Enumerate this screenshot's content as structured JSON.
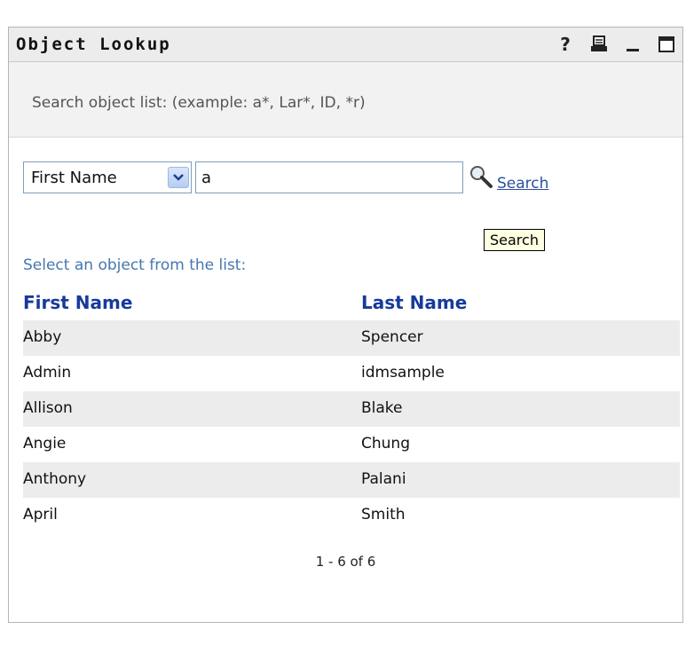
{
  "portlet": {
    "title": "Object Lookup",
    "help_symbol": "?"
  },
  "hint": "Search object list: (example: a*, Lar*, ID, *r)",
  "search": {
    "field_selected": "First Name",
    "query_value": "a",
    "link_label": "Search",
    "tooltip": "Search"
  },
  "list": {
    "caption": "Select an object from the list:",
    "columns": [
      "First Name",
      "Last Name"
    ],
    "rows": [
      {
        "first": "Abby",
        "last": "Spencer"
      },
      {
        "first": "Admin",
        "last": "idmsample"
      },
      {
        "first": "Allison",
        "last": "Blake"
      },
      {
        "first": "Angie",
        "last": "Chung"
      },
      {
        "first": "Anthony",
        "last": "Palani"
      },
      {
        "first": "April",
        "last": "Smith"
      }
    ],
    "pager": "1 - 6 of 6"
  },
  "colors": {
    "header_link": "#173a9b",
    "caption": "#4677b0",
    "row_alt": "#ececec"
  },
  "icons": [
    "help-icon",
    "print-icon",
    "minimize-icon",
    "maximize-icon",
    "chevron-down-icon",
    "search-icon"
  ]
}
